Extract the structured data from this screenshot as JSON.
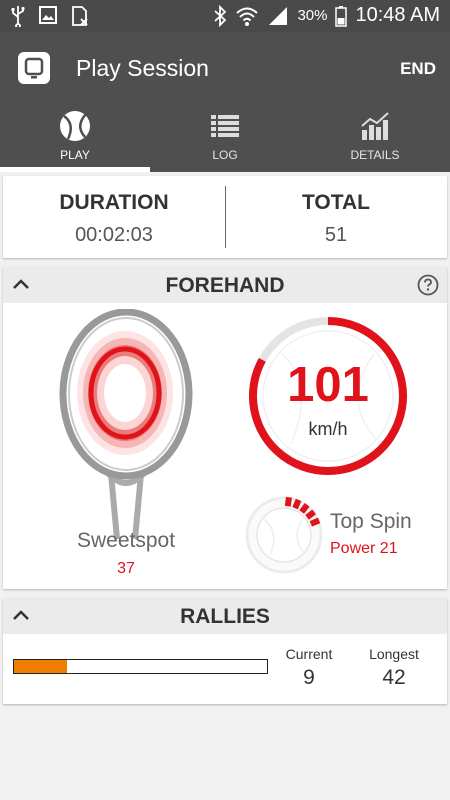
{
  "status_bar": {
    "battery_percent": "30%",
    "time": "10:48 AM",
    "icons": [
      "usb-icon",
      "image-icon",
      "sim-icon",
      "bluetooth-icon",
      "wifi-icon",
      "signal-icon",
      "battery-icon"
    ]
  },
  "app_bar": {
    "title": "Play Session",
    "end_label": "END"
  },
  "tabs": [
    {
      "label": "PLAY",
      "icon": "tennis-ball-icon",
      "active": true
    },
    {
      "label": "LOG",
      "icon": "list-icon",
      "active": false
    },
    {
      "label": "DETAILS",
      "icon": "bar-chart-icon",
      "active": false
    }
  ],
  "summary": {
    "duration_label": "DURATION",
    "duration_value": "00:02:03",
    "total_label": "TOTAL",
    "total_value": "51"
  },
  "forehand": {
    "title": "FOREHAND",
    "sweetspot_label": "Sweetspot",
    "sweetspot_value": "37",
    "speed_value": "101",
    "speed_unit": "km/h",
    "speed_fraction": 0.83,
    "spin_label": "Top Spin",
    "spin_power": "Power 21",
    "spin_fraction": 0.21
  },
  "rallies": {
    "title": "RALLIES",
    "progress_fraction": 0.21,
    "current_label": "Current",
    "current_value": "9",
    "longest_label": "Longest",
    "longest_value": "42"
  },
  "colors": {
    "accent_red": "#e0121a",
    "rally_orange": "#f07d00",
    "header_gray": "#4f4f4f"
  }
}
